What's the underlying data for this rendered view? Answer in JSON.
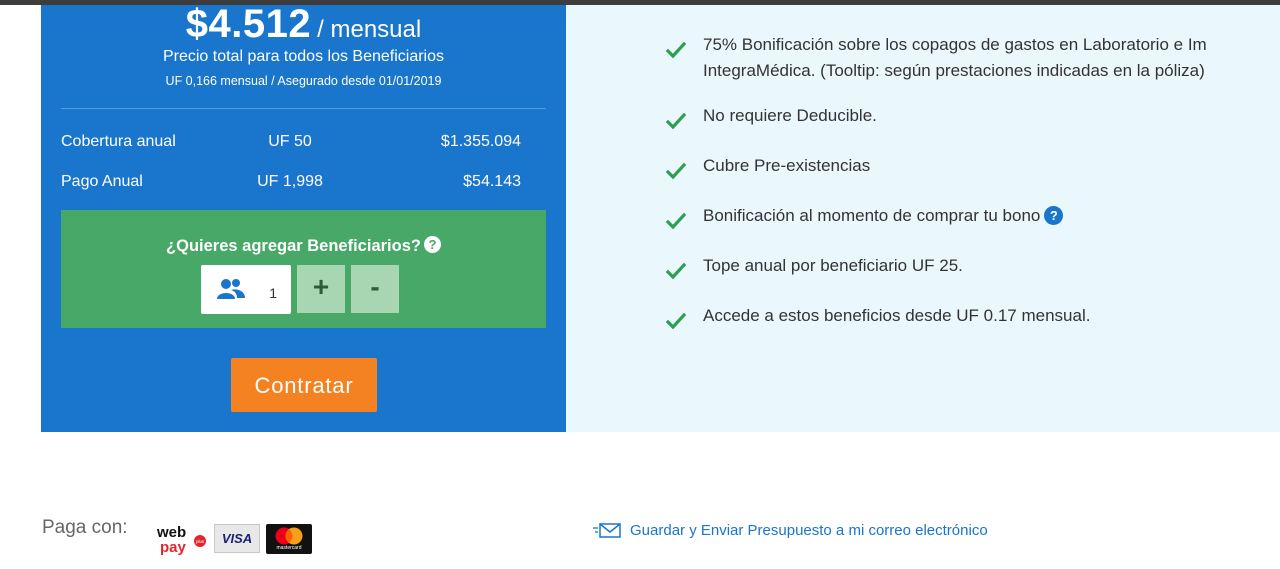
{
  "plan": {
    "price": "$4.512",
    "period": "/ mensual",
    "subtitle": "Precio total para todos los Beneficiarios",
    "uf_note": "UF 0,166 mensual / Asegurado desde 01/01/2019",
    "rows": [
      {
        "label": "Cobertura anual",
        "uf": "UF 50",
        "clp": "$1.355.094"
      },
      {
        "label": "Pago Anual",
        "uf": "UF 1,998",
        "clp": "$54.143"
      }
    ],
    "beneficiaries": {
      "title": "¿Quieres agregar Beneficiarios?",
      "help": "?",
      "count": "1",
      "plus": "+",
      "minus": "-"
    },
    "cta": "Contratar"
  },
  "benefits": [
    {
      "line1": "75% Bonificación sobre los copagos de gastos en Laboratorio e Im",
      "line2": "IntegraMédica. (Tooltip: según prestaciones indicadas en la póliza)"
    },
    {
      "line1": "No requiere Deducible."
    },
    {
      "line1": "Cubre Pre-existencias"
    },
    {
      "line1": "Bonificación al momento de comprar tu bono",
      "help": "?"
    },
    {
      "line1": "Tope anual por beneficiario UF 25."
    },
    {
      "line1": "Accede a estos beneficios desde UF 0.17 mensual."
    }
  ],
  "footer": {
    "pay_label": "Paga con:",
    "webpay_word1": "web",
    "webpay_word2": "pay",
    "webpay_plus": "plus",
    "visa": "VISA",
    "mastercard": "mastercard",
    "save_link": "Guardar y Enviar Presupuesto a mi correo electrónico"
  },
  "colors": {
    "card_blue": "#1a75cc",
    "green_box": "#48a868",
    "cta_orange": "#f58220",
    "check_green": "#2e9e4f",
    "panel_bg": "#eaf7fd"
  }
}
